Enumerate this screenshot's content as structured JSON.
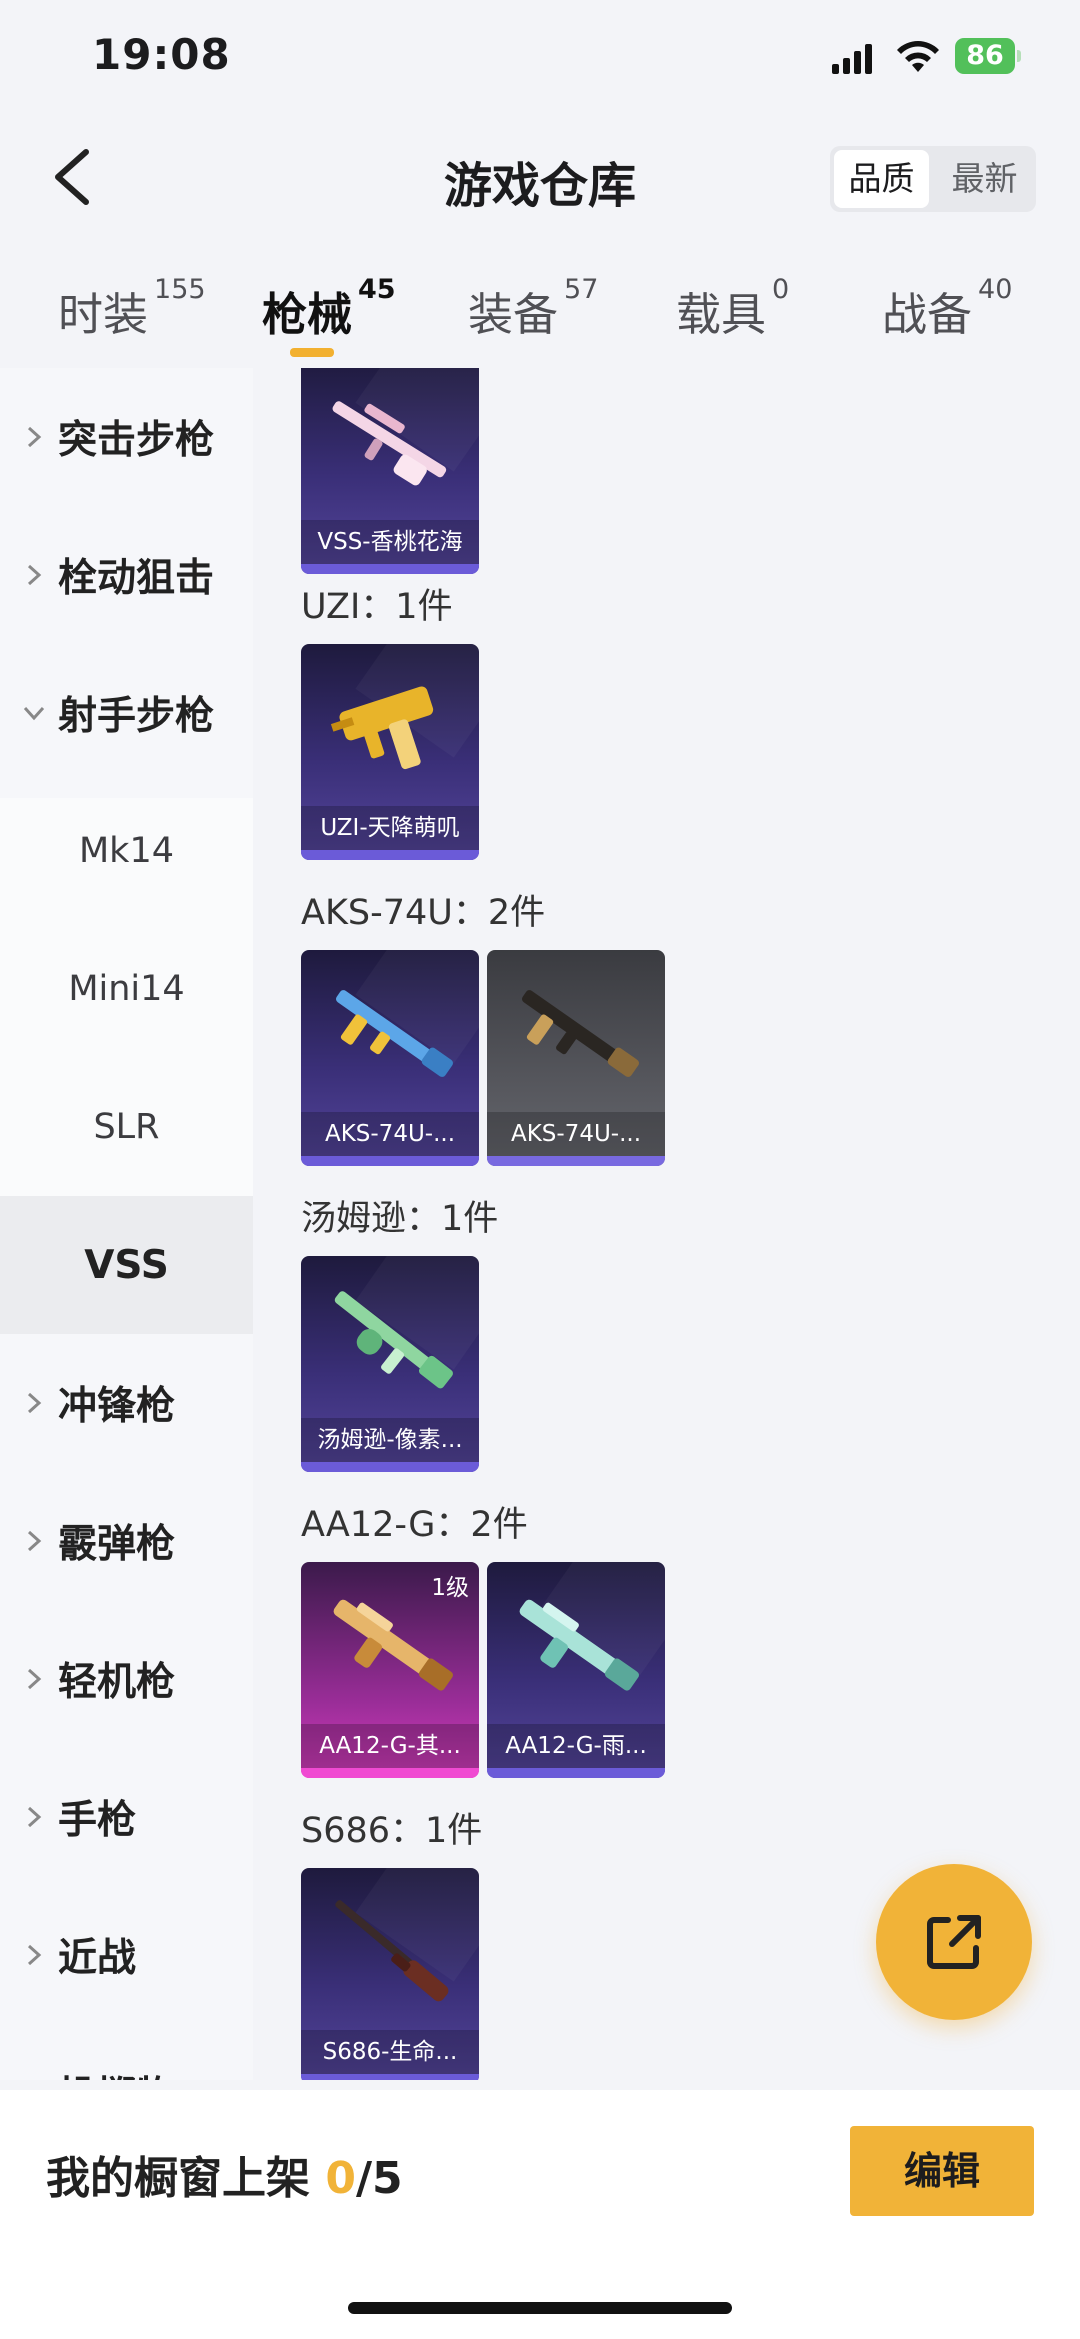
{
  "status_bar": {
    "time": "19:08",
    "battery": "86"
  },
  "header": {
    "title": "游戏仓库",
    "sort_options": [
      "品质",
      "最新"
    ],
    "active_sort": "品质"
  },
  "tabs": [
    {
      "label": "时装",
      "count": "155"
    },
    {
      "label": "枪械",
      "count": "45",
      "active": true
    },
    {
      "label": "装备",
      "count": "57"
    },
    {
      "label": "载具",
      "count": "0"
    },
    {
      "label": "战备",
      "count": "40"
    }
  ],
  "sidebar": {
    "items": [
      {
        "label": "突击步枪"
      },
      {
        "label": "栓动狙击"
      },
      {
        "label": "射手步枪",
        "expanded": true
      },
      {
        "label": "Mk14"
      },
      {
        "label": "Mini14"
      },
      {
        "label": "SLR"
      },
      {
        "label": "VSS",
        "selected": true
      },
      {
        "label": "冲锋枪"
      },
      {
        "label": "霰弹枪"
      },
      {
        "label": "轻机枪"
      },
      {
        "label": "手枪"
      },
      {
        "label": "近战"
      },
      {
        "label": "投掷物"
      }
    ]
  },
  "groups": [
    {
      "title": "",
      "items": [
        {
          "name": "VSS-香桃花海",
          "rarity": "purple",
          "icon": "sniper-rifle-icon"
        }
      ]
    },
    {
      "title": "UZI：1件",
      "items": [
        {
          "name": "UZI-天降萌叽",
          "rarity": "purple",
          "icon": "uzi-icon"
        }
      ]
    },
    {
      "title": "AKS-74U：2件",
      "items": [
        {
          "name": "AKS-74U-...",
          "rarity": "purple",
          "icon": "smg-icon"
        },
        {
          "name": "AKS-74U-...",
          "rarity": "gray",
          "icon": "smg-icon"
        }
      ]
    },
    {
      "title": "汤姆逊：1件",
      "items": [
        {
          "name": "汤姆逊-像素...",
          "rarity": "purple",
          "icon": "tommy-gun-icon"
        }
      ]
    },
    {
      "title": "AA12-G：2件",
      "items": [
        {
          "name": "AA12-G-其...",
          "rarity": "pink",
          "level": "1级",
          "icon": "shotgun-icon"
        },
        {
          "name": "AA12-G-雨...",
          "rarity": "purple",
          "icon": "shotgun-icon"
        }
      ]
    },
    {
      "title": "S686：1件",
      "items": [
        {
          "name": "S686-生命...",
          "rarity": "purple",
          "icon": "double-barrel-icon"
        }
      ]
    }
  ],
  "showcase": {
    "label": "我的橱窗上架",
    "current": "0",
    "max": "/5"
  },
  "edit_label": "编辑",
  "colors": {
    "accent": "#f1b338",
    "purple_card": "#3a2f78",
    "pink_card": "#d43dbc"
  }
}
